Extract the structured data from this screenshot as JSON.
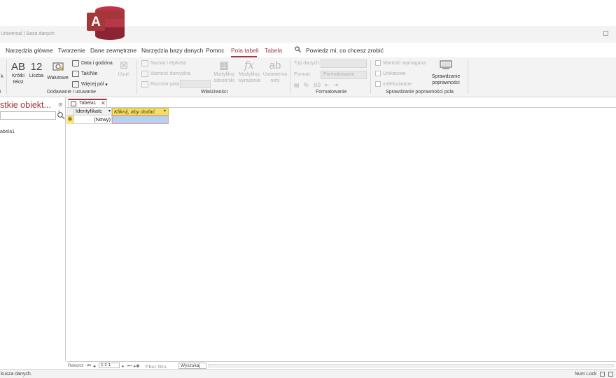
{
  "window": {
    "title": "Uniwersal | Baza danych",
    "logo_icon": "access-logo-icon",
    "logo_letter": "A",
    "brand_color": "#a4373a"
  },
  "tabs": [
    "Narzędzia główne",
    "Tworzenie",
    "Dane zewnętrzne",
    "Narzędzia bazy danych",
    "Pomoc",
    "Pola tabeli",
    "Tabela"
  ],
  "active_tab": "Pola tabeli",
  "tell_me": "Powiedz mi, co chcesz zrobić",
  "ribbon": {
    "group1": {
      "cut_label": "k",
      "short_text": "Krótki tekst",
      "short_text_glyph": "AB",
      "number": "Liczba",
      "number_glyph": "12",
      "currency": "Walutowe",
      "date_time": "Data i godzina",
      "yes_no": "Tak/Nie",
      "more_fields": "Więcej pól",
      "delete": "Usuń",
      "label": "Dodawanie i usuwanie"
    },
    "group0_label": "i",
    "properties": {
      "name_caption": "Nazwa i etykieta",
      "default_value": "Wartość domyślna",
      "field_size": "Rozmiar pola",
      "modify_lookups": "Modyfikuj odnośniki",
      "modify_expression": "Modyfikuj wyrażenia",
      "memo_settings": "Ustawienia noty",
      "label": "Właściwości"
    },
    "formatting": {
      "data_type": "Typ danych:",
      "format": "Format:",
      "format_value": "Formatowanie",
      "label": "Formatowanie"
    },
    "validation": {
      "required": "Wartość wymagana",
      "unique": "Unikatowe",
      "indexed": "Indeksowane",
      "validation_btn": "Sprawdzanie poprawności",
      "label": "Sprawdzanie poprawności pola"
    }
  },
  "nav": {
    "title": "stkie obiekt...",
    "items": [
      "abela1"
    ]
  },
  "document": {
    "tab_label": "Tabela1",
    "col1_header": "Identyfikatc",
    "col2_header": "Kliknij, aby dodać",
    "new_row_marker": "✱",
    "new_row_value": "(Nowy)"
  },
  "record_nav": {
    "label": "Rekord:",
    "position": "1 z 1",
    "no_filter": "Bez filtra",
    "search": "Wyszukaj"
  },
  "status": {
    "left": "kusza danych.",
    "num_lock": "Num Lock"
  }
}
